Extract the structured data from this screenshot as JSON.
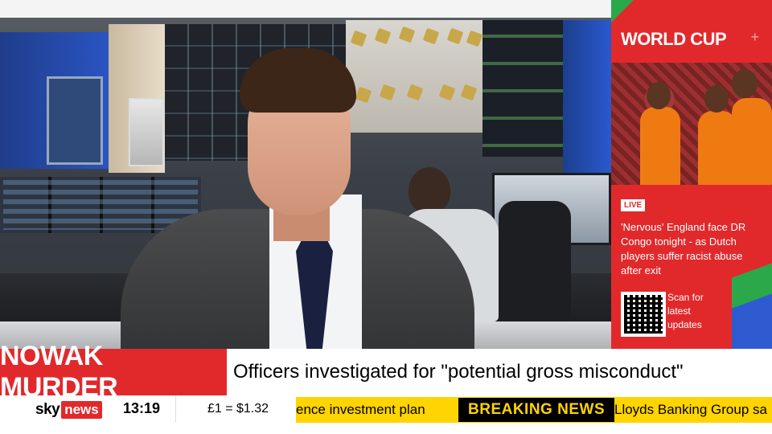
{
  "panel": {
    "title": "WORLD CUP",
    "plus": "+",
    "live_label": "LIVE",
    "story": "'Nervous' England face DR Congo tonight - as Dutch players suffer racist abuse after exit",
    "qr_caption": "Scan for latest updates"
  },
  "headline": {
    "tag": "NOWAK MURDER",
    "text": "Officers investigated for \"potential gross misconduct\""
  },
  "footer": {
    "brand_sky": "sky",
    "brand_news": "news",
    "time": "13:19",
    "currency": "£1 = $1.32",
    "ticker_left": "ence investment plan",
    "breaking": "BREAKING NEWS",
    "ticker_right": "Lloyds Banking Group sa"
  },
  "colors": {
    "brand_red": "#e1292c",
    "ticker_yellow": "#ffd400",
    "accent_green": "#2aa84a"
  }
}
